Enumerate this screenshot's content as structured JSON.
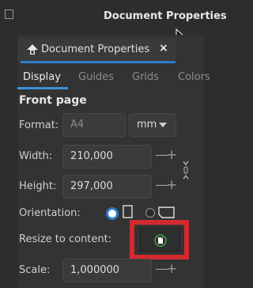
{
  "window": {
    "title": "Document Properties"
  },
  "dock_tab": {
    "label": "Document Properties",
    "close": "×"
  },
  "tabs": [
    {
      "label": "Display",
      "active": true
    },
    {
      "label": "Guides",
      "active": false
    },
    {
      "label": "Grids",
      "active": false
    },
    {
      "label": "Colors",
      "active": false
    }
  ],
  "section_title": "Front page",
  "format": {
    "label": "Format:",
    "value": "A4",
    "unit": "mm"
  },
  "width": {
    "label": "Width:",
    "value": "210,000"
  },
  "height": {
    "label": "Height:",
    "value": "297,000"
  },
  "orientation": {
    "label": "Orientation:",
    "selected": "portrait"
  },
  "resize": {
    "label": "Resize to content:"
  },
  "scale": {
    "label": "Scale:",
    "value": "1,000000"
  },
  "stepper": {
    "minus": "—",
    "plus": "+"
  },
  "colors": {
    "accent": "#2b7bc8",
    "highlight": "#d42a2f",
    "icon_green": "#3aa53a"
  }
}
